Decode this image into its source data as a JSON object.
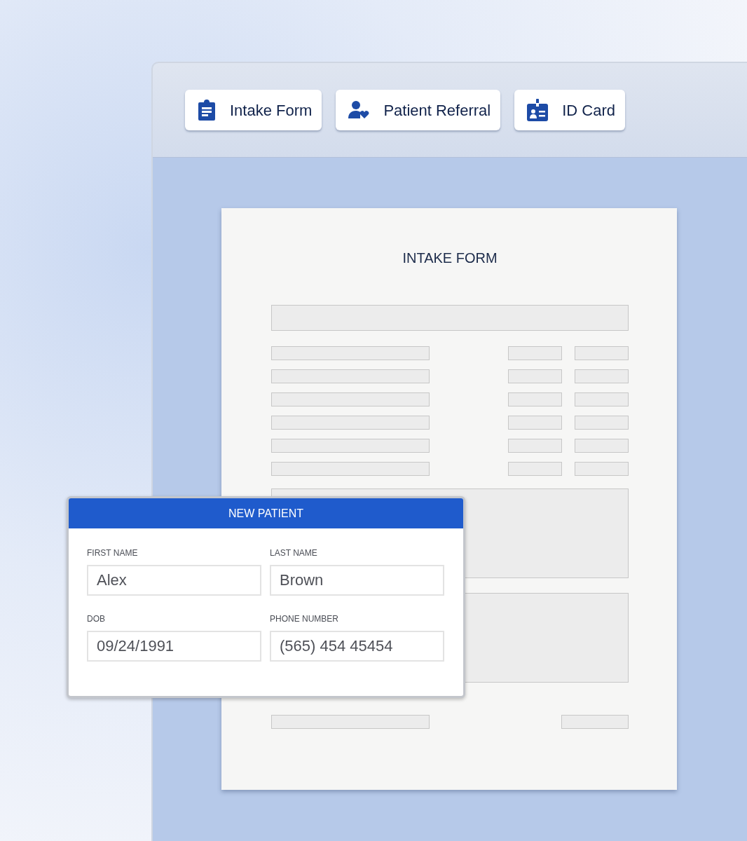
{
  "toolbar": {
    "buttons": [
      {
        "label": "Intake Form"
      },
      {
        "label": "Patient Referral"
      },
      {
        "label": "ID Card"
      }
    ]
  },
  "document": {
    "title": "INTAKE FORM"
  },
  "new_patient_card": {
    "title": "NEW PATIENT",
    "fields": [
      {
        "label": "FIRST NAME",
        "value": "Alex"
      },
      {
        "label": "LAST NAME",
        "value": "Brown"
      },
      {
        "label": "DOB",
        "value": "09/24/1991"
      },
      {
        "label": "PHONE NUMBER",
        "value": "(565) 454 45454"
      }
    ]
  }
}
